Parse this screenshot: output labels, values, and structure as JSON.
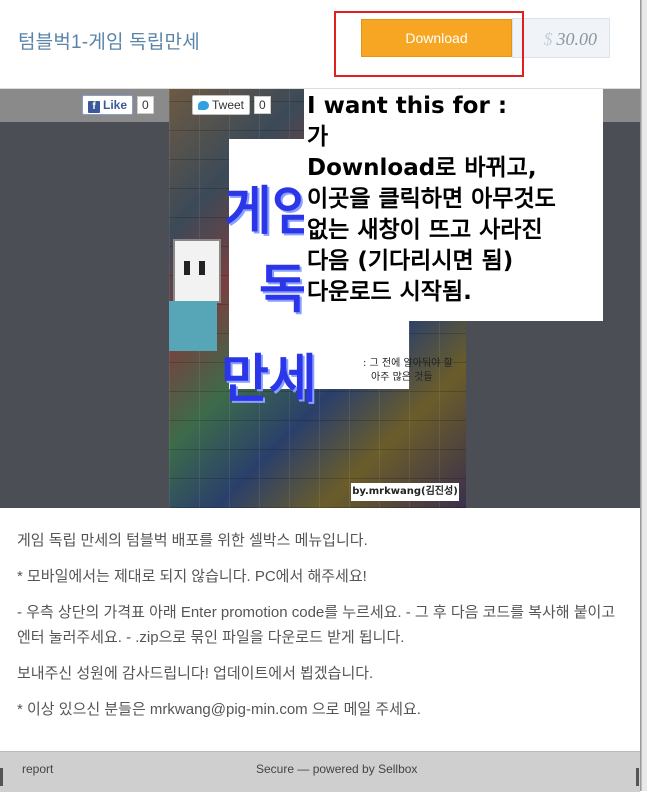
{
  "header": {
    "title": "텀블벅1-게임 독립만세",
    "download_label": "Download",
    "price_currency": "$",
    "price_value": "30.00"
  },
  "social": {
    "facebook_label": "Like",
    "facebook_count": "0",
    "twitter_label": "Tweet",
    "twitter_count": "0"
  },
  "poster": {
    "big_line_1": "게임",
    "big_line_2": "독",
    "big_line_3": "만세",
    "subtitle_1": ": 그 전에 알아둬야 할",
    "subtitle_2": "아주 많은 것들",
    "byline": "by.mrkwang(김진성)"
  },
  "annotation": {
    "lines": [
      "I want this for :",
      "가",
      "Download로 바뀌고,",
      "이곳을 클릭하면 아무것도",
      "없는 새창이 뜨고 사라진",
      "다음 (기다리시면 됨)",
      "다운로드 시작됨."
    ]
  },
  "description": {
    "p1": "게임 독립 만세의 텀블벅 배포를 위한 셀박스 메뉴입니다.",
    "p2": "* 모바일에서는 제대로 되지 않습니다. PC에서 해주세요!",
    "p3": "- 우측 상단의 가격표 아래 Enter promotion code를 누르세요. - 그 후 다음 코드를 복사해 붙이고 엔터 눌러주세요. - .zip으로 묶인 파일을 다운로드 받게 됩니다.",
    "p4": "보내주신 성원에 감사드립니다! 업데이트에서 뵙겠습니다.",
    "p5": "* 이상 있으신 분들은 mrkwang@pig-min.com 으로 메일 주세요."
  },
  "footer": {
    "report_label": "report",
    "secure_label": "Secure — powered by Sellbox"
  },
  "colors": {
    "download_button": "#f6a623",
    "annotation_box": "#e02020",
    "title": "#5a85a8"
  }
}
